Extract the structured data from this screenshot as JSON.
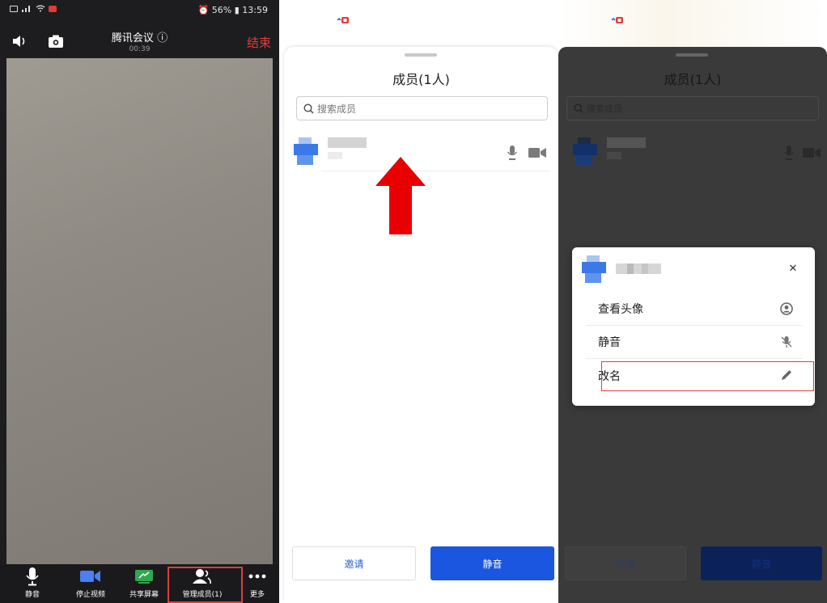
{
  "meeting": {
    "title": "腾讯会议",
    "elapsed": "00:39",
    "end_label": "结束",
    "status_bar": {
      "battery": "56%",
      "time": "13:59"
    }
  },
  "toolbar": {
    "mute": "静音",
    "stop_video": "停止视频",
    "share_screen": "共享屏幕",
    "manage_members": "管理成员(1)",
    "more": "更多"
  },
  "members_sheet": {
    "title": "成员(1人)",
    "search_placeholder": "搜索成员",
    "invite_label": "邀请",
    "mute_all_label": "静音"
  },
  "member_menu": {
    "items": [
      {
        "label": "查看头像",
        "icon": "person-circle-icon"
      },
      {
        "label": "静音",
        "icon": "mic-muted-icon"
      },
      {
        "label": "改名",
        "icon": "pencil-icon"
      }
    ]
  },
  "colors": {
    "accent_blue": "#1a56e0",
    "end_red": "#e43b3b",
    "highlight_red": "#e23b3b"
  }
}
